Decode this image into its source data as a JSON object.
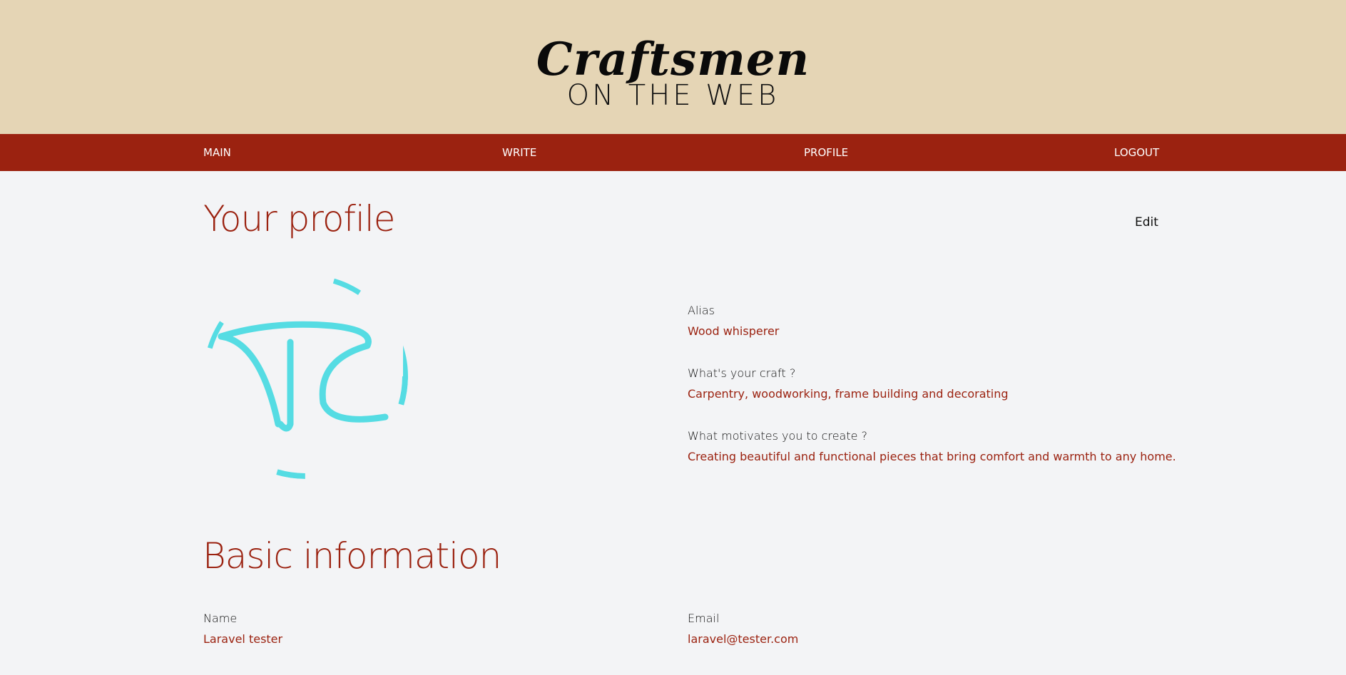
{
  "brand": {
    "title": "Craftsmen",
    "subtitle": "ON THE WEB"
  },
  "nav": {
    "main": "MAIN",
    "write": "WRITE",
    "profile": "PROFILE",
    "logout": "LOGOUT"
  },
  "profile": {
    "heading": "Your profile",
    "edit_label": "Edit",
    "fields": [
      {
        "label": "Alias",
        "value": "Wood whisperer"
      },
      {
        "label": "What's your craft ?",
        "value": "Carpentry, woodworking, frame building and decorating"
      },
      {
        "label": "What motivates you to create ?",
        "value": "Creating beautiful and functional pieces that bring comfort and warmth to any home."
      }
    ]
  },
  "basic_info": {
    "heading": "Basic information",
    "name_label": "Name",
    "name_value": "Laravel tester",
    "email_label": "Email",
    "email_value": "laravel@tester.com"
  },
  "colors": {
    "header_bg": "#e5d5b5",
    "nav_bg": "#9b2210",
    "accent": "#9b2210",
    "avatar_stroke": "#55dce3",
    "page_bg": "#f3f4f6"
  },
  "icons": {
    "avatar": "monogram-avatar-icon"
  }
}
